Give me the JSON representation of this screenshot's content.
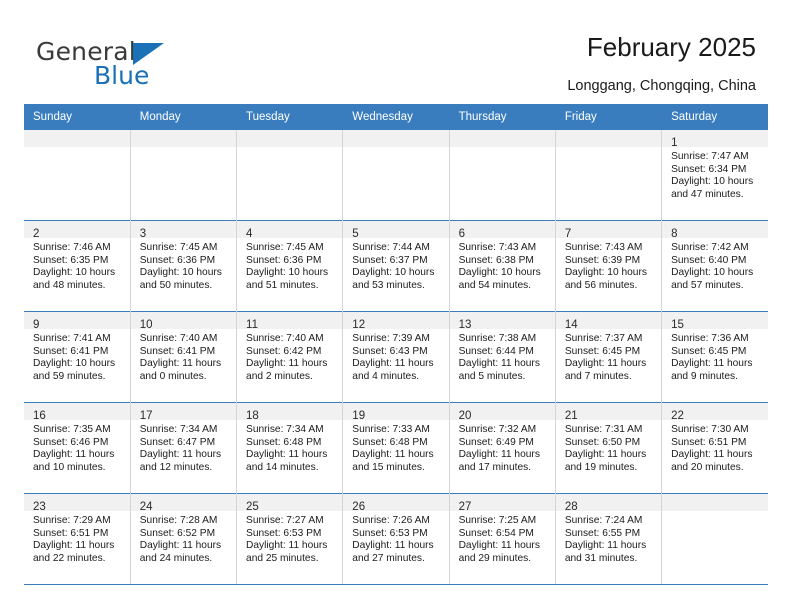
{
  "brand": {
    "name_top": "General",
    "name_bottom": "Blue",
    "triangle_color": "#1a71b8",
    "text_color": "#3a3a3a"
  },
  "header": {
    "title": "February 2025",
    "location": "Longgang, Chongqing, China"
  },
  "theme": {
    "header_bar": "#3a7dbf",
    "day_band": "#f1f1f1",
    "row_rule": "#3a7dbf",
    "cell_divider": "#d5d5d5"
  },
  "weekdays": [
    "Sunday",
    "Monday",
    "Tuesday",
    "Wednesday",
    "Thursday",
    "Friday",
    "Saturday"
  ],
  "labels": {
    "sunrise": "Sunrise:",
    "sunset": "Sunset:",
    "daylight": "Daylight:"
  },
  "weeks": [
    [
      {
        "empty": true
      },
      {
        "empty": true
      },
      {
        "empty": true
      },
      {
        "empty": true
      },
      {
        "empty": true
      },
      {
        "empty": true
      },
      {
        "day": "1",
        "sunrise": "Sunrise: 7:47 AM",
        "sunset": "Sunset: 6:34 PM",
        "daylight_1": "Daylight: 10 hours",
        "daylight_2": "and 47 minutes."
      }
    ],
    [
      {
        "day": "2",
        "sunrise": "Sunrise: 7:46 AM",
        "sunset": "Sunset: 6:35 PM",
        "daylight_1": "Daylight: 10 hours",
        "daylight_2": "and 48 minutes."
      },
      {
        "day": "3",
        "sunrise": "Sunrise: 7:45 AM",
        "sunset": "Sunset: 6:36 PM",
        "daylight_1": "Daylight: 10 hours",
        "daylight_2": "and 50 minutes."
      },
      {
        "day": "4",
        "sunrise": "Sunrise: 7:45 AM",
        "sunset": "Sunset: 6:36 PM",
        "daylight_1": "Daylight: 10 hours",
        "daylight_2": "and 51 minutes."
      },
      {
        "day": "5",
        "sunrise": "Sunrise: 7:44 AM",
        "sunset": "Sunset: 6:37 PM",
        "daylight_1": "Daylight: 10 hours",
        "daylight_2": "and 53 minutes."
      },
      {
        "day": "6",
        "sunrise": "Sunrise: 7:43 AM",
        "sunset": "Sunset: 6:38 PM",
        "daylight_1": "Daylight: 10 hours",
        "daylight_2": "and 54 minutes."
      },
      {
        "day": "7",
        "sunrise": "Sunrise: 7:43 AM",
        "sunset": "Sunset: 6:39 PM",
        "daylight_1": "Daylight: 10 hours",
        "daylight_2": "and 56 minutes."
      },
      {
        "day": "8",
        "sunrise": "Sunrise: 7:42 AM",
        "sunset": "Sunset: 6:40 PM",
        "daylight_1": "Daylight: 10 hours",
        "daylight_2": "and 57 minutes."
      }
    ],
    [
      {
        "day": "9",
        "sunrise": "Sunrise: 7:41 AM",
        "sunset": "Sunset: 6:41 PM",
        "daylight_1": "Daylight: 10 hours",
        "daylight_2": "and 59 minutes."
      },
      {
        "day": "10",
        "sunrise": "Sunrise: 7:40 AM",
        "sunset": "Sunset: 6:41 PM",
        "daylight_1": "Daylight: 11 hours",
        "daylight_2": "and 0 minutes."
      },
      {
        "day": "11",
        "sunrise": "Sunrise: 7:40 AM",
        "sunset": "Sunset: 6:42 PM",
        "daylight_1": "Daylight: 11 hours",
        "daylight_2": "and 2 minutes."
      },
      {
        "day": "12",
        "sunrise": "Sunrise: 7:39 AM",
        "sunset": "Sunset: 6:43 PM",
        "daylight_1": "Daylight: 11 hours",
        "daylight_2": "and 4 minutes."
      },
      {
        "day": "13",
        "sunrise": "Sunrise: 7:38 AM",
        "sunset": "Sunset: 6:44 PM",
        "daylight_1": "Daylight: 11 hours",
        "daylight_2": "and 5 minutes."
      },
      {
        "day": "14",
        "sunrise": "Sunrise: 7:37 AM",
        "sunset": "Sunset: 6:45 PM",
        "daylight_1": "Daylight: 11 hours",
        "daylight_2": "and 7 minutes."
      },
      {
        "day": "15",
        "sunrise": "Sunrise: 7:36 AM",
        "sunset": "Sunset: 6:45 PM",
        "daylight_1": "Daylight: 11 hours",
        "daylight_2": "and 9 minutes."
      }
    ],
    [
      {
        "day": "16",
        "sunrise": "Sunrise: 7:35 AM",
        "sunset": "Sunset: 6:46 PM",
        "daylight_1": "Daylight: 11 hours",
        "daylight_2": "and 10 minutes."
      },
      {
        "day": "17",
        "sunrise": "Sunrise: 7:34 AM",
        "sunset": "Sunset: 6:47 PM",
        "daylight_1": "Daylight: 11 hours",
        "daylight_2": "and 12 minutes."
      },
      {
        "day": "18",
        "sunrise": "Sunrise: 7:34 AM",
        "sunset": "Sunset: 6:48 PM",
        "daylight_1": "Daylight: 11 hours",
        "daylight_2": "and 14 minutes."
      },
      {
        "day": "19",
        "sunrise": "Sunrise: 7:33 AM",
        "sunset": "Sunset: 6:48 PM",
        "daylight_1": "Daylight: 11 hours",
        "daylight_2": "and 15 minutes."
      },
      {
        "day": "20",
        "sunrise": "Sunrise: 7:32 AM",
        "sunset": "Sunset: 6:49 PM",
        "daylight_1": "Daylight: 11 hours",
        "daylight_2": "and 17 minutes."
      },
      {
        "day": "21",
        "sunrise": "Sunrise: 7:31 AM",
        "sunset": "Sunset: 6:50 PM",
        "daylight_1": "Daylight: 11 hours",
        "daylight_2": "and 19 minutes."
      },
      {
        "day": "22",
        "sunrise": "Sunrise: 7:30 AM",
        "sunset": "Sunset: 6:51 PM",
        "daylight_1": "Daylight: 11 hours",
        "daylight_2": "and 20 minutes."
      }
    ],
    [
      {
        "day": "23",
        "sunrise": "Sunrise: 7:29 AM",
        "sunset": "Sunset: 6:51 PM",
        "daylight_1": "Daylight: 11 hours",
        "daylight_2": "and 22 minutes."
      },
      {
        "day": "24",
        "sunrise": "Sunrise: 7:28 AM",
        "sunset": "Sunset: 6:52 PM",
        "daylight_1": "Daylight: 11 hours",
        "daylight_2": "and 24 minutes."
      },
      {
        "day": "25",
        "sunrise": "Sunrise: 7:27 AM",
        "sunset": "Sunset: 6:53 PM",
        "daylight_1": "Daylight: 11 hours",
        "daylight_2": "and 25 minutes."
      },
      {
        "day": "26",
        "sunrise": "Sunrise: 7:26 AM",
        "sunset": "Sunset: 6:53 PM",
        "daylight_1": "Daylight: 11 hours",
        "daylight_2": "and 27 minutes."
      },
      {
        "day": "27",
        "sunrise": "Sunrise: 7:25 AM",
        "sunset": "Sunset: 6:54 PM",
        "daylight_1": "Daylight: 11 hours",
        "daylight_2": "and 29 minutes."
      },
      {
        "day": "28",
        "sunrise": "Sunrise: 7:24 AM",
        "sunset": "Sunset: 6:55 PM",
        "daylight_1": "Daylight: 11 hours",
        "daylight_2": "and 31 minutes."
      },
      {
        "empty": true
      }
    ]
  ]
}
